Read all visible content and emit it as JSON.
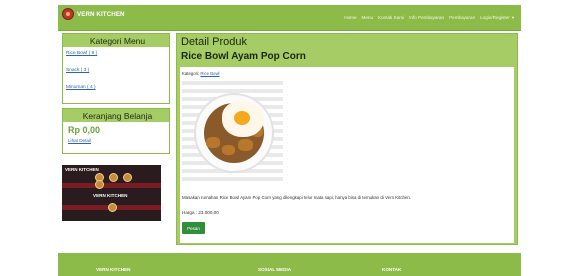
{
  "header": {
    "brand": "VERN KITCHEN",
    "nav": [
      {
        "label": "Home"
      },
      {
        "label": "Menu"
      },
      {
        "label": "Kontak Kami"
      },
      {
        "label": "Info Pembayaran"
      },
      {
        "label": "Pembayaran"
      },
      {
        "label": "Login/Register",
        "caret": "▼"
      }
    ]
  },
  "sidebar": {
    "category_title": "Kategori Menu",
    "categories": [
      {
        "label": "Rice Bowl ( 8 )"
      },
      {
        "label": "Snack ( 3 )"
      },
      {
        "label": "Minuman ( 4 )"
      }
    ],
    "cart_title": "Keranjang Belanja",
    "cart_total": "Rp 0,00",
    "cart_link": "Lihat Detail",
    "banner": {
      "line1": "VERN KITCHEN",
      "line2": "VERN KITCHEN"
    }
  },
  "main": {
    "page_title": "Detail Produk",
    "product_name": "Rice Bowl Ayam Pop Corn",
    "category_prefix": "Kategori:",
    "category_link": "Rice Bowl",
    "description": "Masakan rumahan Rice Bowl Ayam Pop Corn yang dilengkapi telur mata sapi, hanya bisa di temukan di Vern Kitchen.",
    "price": "Harga : 23.000,00",
    "order_button": "Pesan"
  },
  "footer": {
    "col1": "VERN KITCHEN",
    "col2": "SOSIAL MEDIA",
    "col3": "KONTAK"
  },
  "colors": {
    "nav_green": "#8dbb4a",
    "panel_green": "#a6cc66",
    "button_green": "#2f8f3a",
    "link_blue": "#2e62b8"
  }
}
